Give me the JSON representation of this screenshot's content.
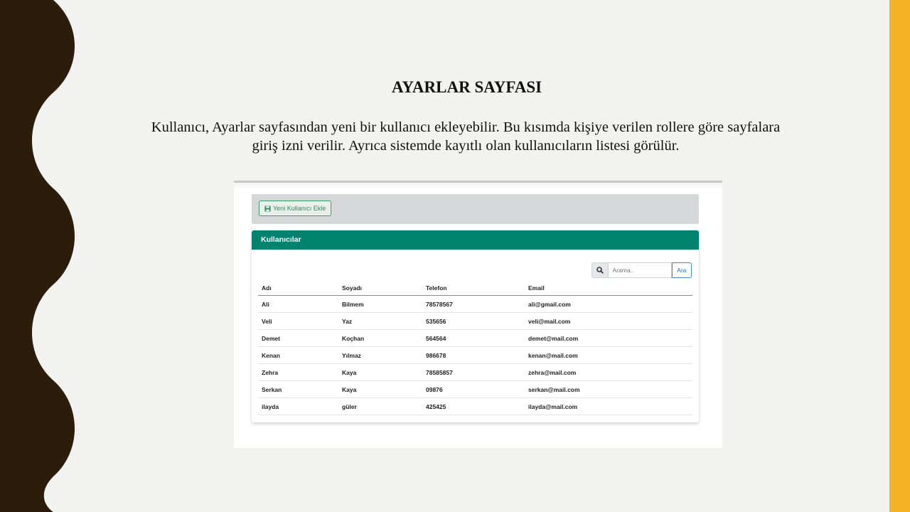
{
  "slide": {
    "title": "AYARLAR SAYFASI",
    "description": "Kullanıcı, Ayarlar sayfasından yeni bir kullanıcı ekleyebilir. Bu kısımda kişiye verilen rollere göre sayfalara giriş izni verilir. Ayrıca sistemde kayıtlı olan kullanıcıların listesi görülür.",
    "colors": {
      "left_wave": "#2b1d0a",
      "right_bar": "#f5b324",
      "card_header": "#00836e"
    }
  },
  "app": {
    "add_user_label": "Yeni Kullanıcı Ekle",
    "add_user_icon": "save-icon",
    "panel_title": "Kullanıcılar",
    "search": {
      "placeholder": "Arama..",
      "button_label": "Ara",
      "icon": "search-icon"
    },
    "table": {
      "headers": [
        "Adı",
        "Soyadı",
        "Telefon",
        "Email"
      ],
      "rows": [
        [
          "Ali",
          "Bilmem",
          "78578567",
          "ali@gmail.com"
        ],
        [
          "Veli",
          "Yaz",
          "535656",
          "veli@mail.com"
        ],
        [
          "Demet",
          "Koçhan",
          "564564",
          "demet@mail.com"
        ],
        [
          "Kenan",
          "Yılmaz",
          "986678",
          "kenan@mail.com"
        ],
        [
          "Zehra",
          "Kaya",
          "78585857",
          "zehra@mail.com"
        ],
        [
          "Serkan",
          "Kaya",
          "09876",
          "serkan@mail.com"
        ],
        [
          "ilayda",
          "güler",
          "425425",
          "ilayda@mail.com"
        ]
      ]
    }
  }
}
